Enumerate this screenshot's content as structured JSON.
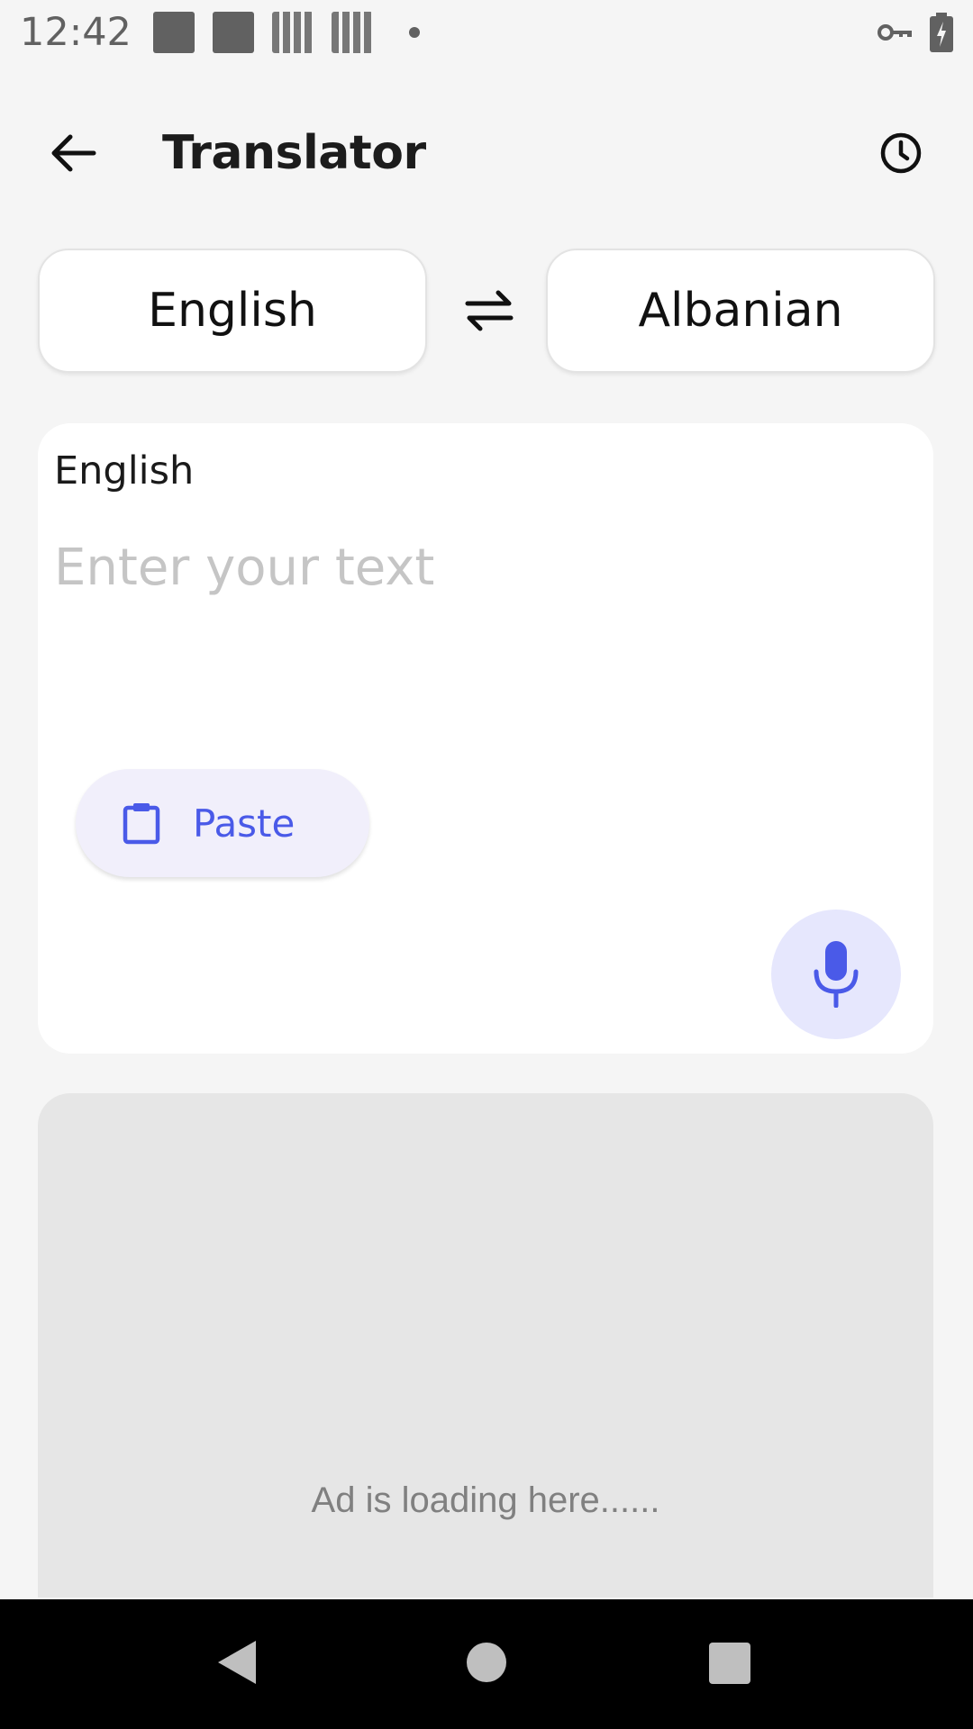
{
  "status_bar": {
    "time": "12:42"
  },
  "app_bar": {
    "title": "Translator"
  },
  "language_selector": {
    "source": "English",
    "target": "Albanian"
  },
  "input_card": {
    "language_label": "English",
    "placeholder": "Enter your text",
    "paste_label": "Paste"
  },
  "ad": {
    "text": "Ad is loading here......"
  },
  "colors": {
    "accent": "#4a5ae8",
    "paste_bg": "#f1effb",
    "mic_bg": "#e6e7fd",
    "background": "#f5f5f5",
    "ad_bg": "#e6e6e6"
  },
  "icons": {
    "back": "arrow-left-icon",
    "history": "clock-icon",
    "swap": "swap-arrows-icon",
    "paste": "clipboard-icon",
    "mic": "microphone-icon"
  }
}
